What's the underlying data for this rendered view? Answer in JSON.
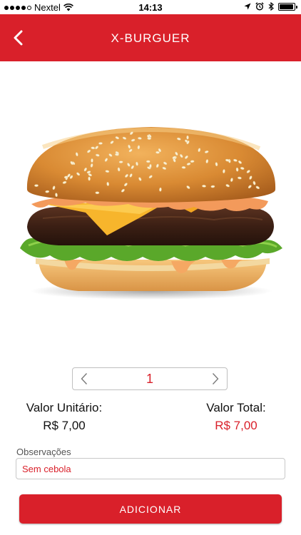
{
  "status_bar": {
    "carrier": "Nextel",
    "time": "14:13",
    "battery_level": 0.95,
    "icons": [
      "signal-dots-icon",
      "wifi-icon",
      "location-arrow-icon",
      "alarm-clock-icon",
      "bluetooth-icon",
      "battery-icon"
    ]
  },
  "header": {
    "title": "X-BURGUER",
    "back_icon": "chevron-left-icon",
    "background": "#d9202a"
  },
  "product_image": {
    "subject": "hamburger-photo"
  },
  "quantity": {
    "value": "1",
    "prev_icon": "chevron-left-icon",
    "next_icon": "chevron-right-icon"
  },
  "pricing": {
    "unit_label": "Valor Unitário:",
    "unit_value": "R$ 7,00",
    "total_label": "Valor Total:",
    "total_value": "R$ 7,00"
  },
  "notes": {
    "label": "Observações",
    "value": "Sem cebola"
  },
  "actions": {
    "add_label": "ADICIONAR"
  },
  "colors": {
    "accent": "#d9202a",
    "text": "#111111"
  }
}
